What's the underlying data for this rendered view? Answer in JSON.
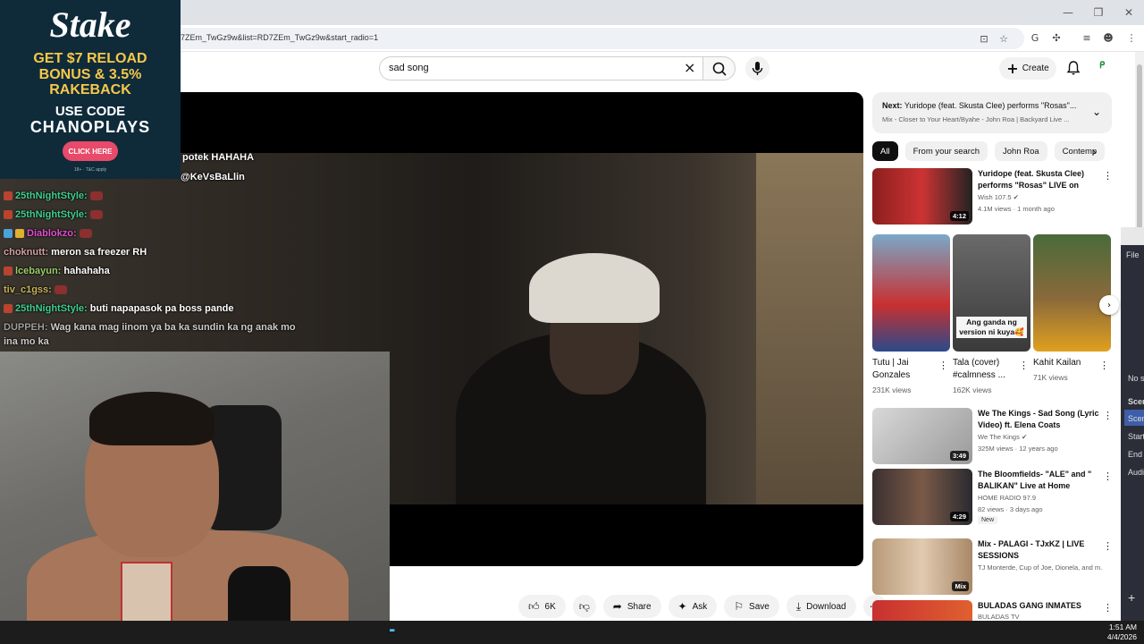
{
  "browser": {
    "url": "7ZEm_TwGz9w&list=RD7ZEm_TwGz9w&start_radio=1",
    "window_controls": [
      "—",
      "❐",
      "✕"
    ]
  },
  "header": {
    "search_value": "sad song",
    "create_label": "Create"
  },
  "stake_ad": {
    "logo": "Stake",
    "offer_lines": [
      "GET $7 RELOAD",
      "BONUS & 3.5%",
      "RAKEBACK"
    ],
    "use_code": "USE CODE",
    "code": "CHANOPLAYS",
    "button": "CLICK HERE",
    "legal": "18+ · T&C apply"
  },
  "chat": [
    {
      "user": "",
      "text": "potek HAHAHA",
      "user_color": "#ffffff"
    },
    {
      "user": "",
      "text": "@KeVsBaLlin",
      "user_color": "#ffffff"
    },
    {
      "user": "25thNightStyle:",
      "text": "",
      "user_color": "#3ecf8e",
      "emote": true
    },
    {
      "user": "25thNightStyle:",
      "text": "",
      "user_color": "#3ecf8e",
      "emote": true
    },
    {
      "user": "Diablokzo:",
      "text": "",
      "user_color": "#e04fd0",
      "emote": true
    },
    {
      "user": "choknutt:",
      "text": "meron sa freezer RH",
      "user_color": "#d0a0a0"
    },
    {
      "user": "lcebayun:",
      "text": "hahahaha",
      "user_color": "#9bd06a"
    },
    {
      "user": "tiv_c1gss:",
      "text": "",
      "user_color": "#c8b45a",
      "emote": true
    },
    {
      "user": "25thNightStyle:",
      "text": "buti napapasok pa boss pande",
      "user_color": "#3ecf8e"
    },
    {
      "user": "DUPPEH:",
      "text": "Wag kana mag iinom ya ba ka sundin ka ng anak mo",
      "user_color": "#a0a0a0"
    },
    {
      "user": "",
      "text": "ina mo ka",
      "user_color": "#ffffff"
    }
  ],
  "actions": {
    "likes": "6K",
    "share": "Share",
    "ask": "Ask",
    "save": "Save",
    "download": "Download"
  },
  "next_card": {
    "prefix": "Next:",
    "title": "Yuridope (feat. Skusta Clee) performs \"Rosas\"...",
    "subtitle": "Mix - Closer to Your Heart/Byahe - John Roa | Backyard Live ..."
  },
  "chips": [
    "All",
    "From your search",
    "John Roa",
    "Contemp"
  ],
  "recs": [
    {
      "title": "Yuridope (feat. Skusta Clee) performs \"Rosas\" LIVE on Wis...",
      "channel": "Wish 107.5",
      "meta": "4.1M views · 1 month ago",
      "duration": "4:12",
      "verified": true
    },
    {
      "title": "We The Kings - Sad Song (Lyric Video) ft. Elena Coats",
      "channel": "We The Kings",
      "meta": "325M views · 12 years ago",
      "duration": "3:49",
      "verified": true
    },
    {
      "title": "The Bloomfields- \"ALE\" and \" BALIKAN\" Live at Home Studio...",
      "channel": "HOME RADIO 97.9",
      "meta": "82 views · 3 days ago",
      "duration": "4:29",
      "badge": "New"
    },
    {
      "title": "Mix - PALAGI - TJxKZ | LIVE SESSIONS",
      "channel": "TJ Monterde, Cup of Joe, Dionela, and m...",
      "meta": "",
      "duration": "Mix"
    },
    {
      "title": "BULADAS GANG INMATES",
      "channel": "BULADAS TV",
      "meta": "",
      "duration": ""
    }
  ],
  "shorts": [
    {
      "title": "Tutu | Jai Gonzales",
      "views": "231K views",
      "caption": ""
    },
    {
      "title": "Tala (cover) #calmness ...",
      "views": "162K views",
      "caption": "Ang ganda ng version ni kuya🥰"
    },
    {
      "title": "Kahit Kailan",
      "views": "71K views",
      "caption": ""
    }
  ],
  "peek_window": {
    "file": "File",
    "items": [
      "No s",
      "Scen",
      "Scen",
      "Start",
      "End",
      "Audi"
    ]
  },
  "taskbar": {
    "time": "1:51 AM",
    "date": "4/4/2026"
  },
  "colors": {
    "stake_bg": "#0f2b3a",
    "stake_gold": "#f7c84a",
    "stake_button": "#e84a6a",
    "chip_active": "#0f0f0f",
    "taskbar": "#1c1c1c"
  }
}
